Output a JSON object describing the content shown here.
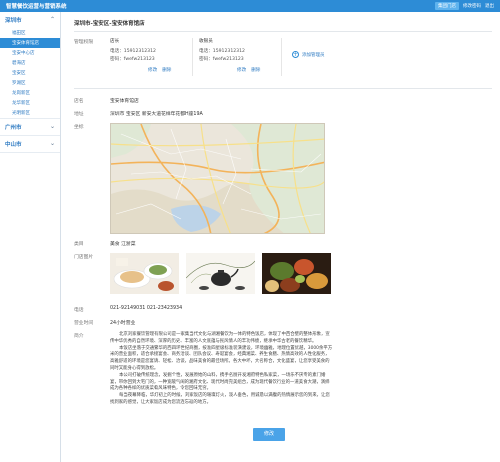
{
  "app": {
    "title": "智慧餐饮运营与营销系统",
    "nav": [
      "集团门店",
      "修改密码",
      "退出"
    ]
  },
  "sidebar": {
    "groups": [
      {
        "label": "深圳市",
        "items": [
          "福田区",
          "宝安体育馆店",
          "宝安中心店",
          "碧海店",
          "宝安区",
          "罗湖区",
          "龙岗新区",
          "龙华新区",
          "光明新区"
        ]
      },
      {
        "label": "广州市"
      },
      {
        "label": "中山市"
      }
    ]
  },
  "breadcrumb": "深圳市-宝安区-宝安体育馆店",
  "admins": {
    "label": "管理权限",
    "cards": [
      {
        "role": "店长",
        "phone": "电话：15912312312",
        "password": "密码：fwefw213123",
        "edit": "修改",
        "delete": "删除"
      },
      {
        "role": "收银员",
        "phone": "电话：15912312312",
        "password": "密码：fwefw213123",
        "edit": "修改",
        "delete": "删除"
      }
    ],
    "add": "添加管理员"
  },
  "store": {
    "name_label": "店名",
    "name": "宝安体育馆店",
    "address_label": "地址",
    "address": "深圳市  宝安区  新安大道花样年花都H座19A",
    "location_label": "坐标",
    "category_label": "类目",
    "category": "美食    江浙菜",
    "photos_label": "门店图片",
    "phone_label": "电话",
    "phone": "021-92149031      021-23423934",
    "hours_label": "营业时间",
    "hours": "24小时营业",
    "intro_label": "简介",
    "intro": [
      "北京刘家餐饮管理有限公司是一家集当代文化与湖湘餐饮为一体的特色饭店，体现了中西合壁的整体形象，宣传中华优秀的自然环境、深厚的历史、丰富的人文底蕴与民风情人的丰功伟绩，继承中华古老的餐饮精华。",
      "本饭店坐落于交通繁华的西四环世纪商圈，按准四星级标准装潢建设，环境幽雅，地理位置优越，3000余平方米的营业面积，适合承接宴会、商务洽谈、团队会议、寿诞宴会，经典湘菜、养生食膳、热情高效的人性化服务，高雅舒适的环境是您宴请、轻松、洽谈，品味美食的最佳场所。各大中坏，大名称合，文化盛宴，让您享受美食的同时又能身心得到放松。",
      "本公司打破传统理念，发掘个性，发展原始的山料，携手名厨开发湘府特色私家菜，一场乐不厌专的素门婚宴，带你回到大宅门的，一种宽敞气阔的湘府文化、现代时尚完美组合，成为现代餐饮行业的一道美食大潮，演绎成为各种各样的优质菜肴风味特色，令您回味无穷。",
      "每当夜幕降临，华灯初上的时候，刘家饭店的璀璨灯火，泼人垂色，用诚恳以满腹的热情展示您的到来，让您找到家的感觉，让大家饭店成为您流连忘返的地方。"
    ]
  },
  "save": "修改"
}
